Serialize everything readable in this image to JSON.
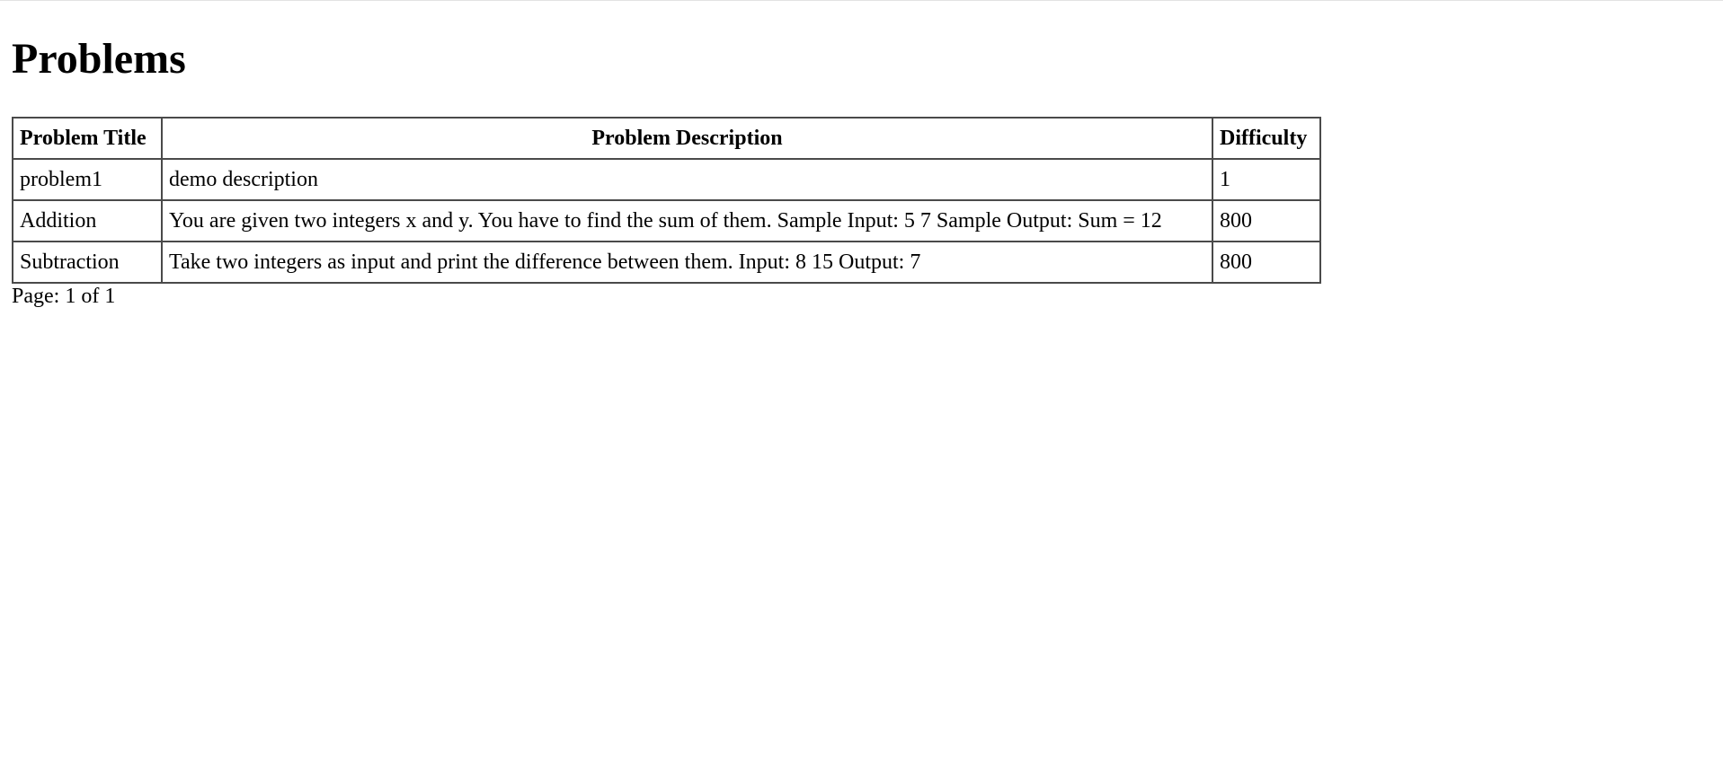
{
  "page": {
    "title": "Problems"
  },
  "table": {
    "headers": {
      "title": "Problem Title",
      "description": "Problem Description",
      "difficulty": "Difficulty"
    },
    "rows": [
      {
        "title": "problem1",
        "description": "demo description",
        "difficulty": "1"
      },
      {
        "title": "Addition",
        "description": "You are given two integers x and y. You have to find the sum of them. Sample Input: 5 7 Sample Output: Sum = 12",
        "difficulty": "800"
      },
      {
        "title": "Subtraction",
        "description": "Take two integers as input and print the difference between them. Input: 8 15 Output: 7",
        "difficulty": "800"
      }
    ]
  },
  "pagination": {
    "text": "Page: 1 of 1"
  }
}
